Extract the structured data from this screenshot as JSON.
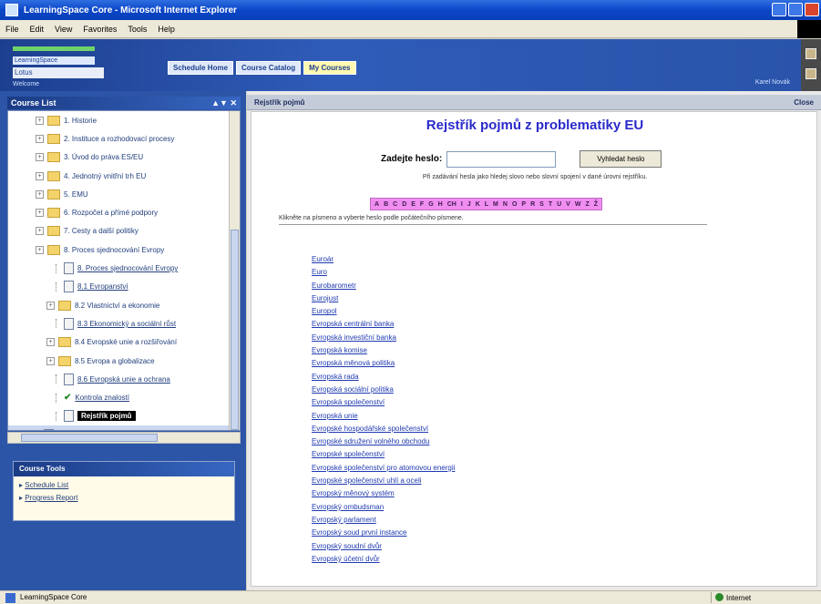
{
  "window": {
    "title": "LearningSpace Core - Microsoft Internet Explorer"
  },
  "menu": [
    "File",
    "Edit",
    "View",
    "Favorites",
    "Tools",
    "Help"
  ],
  "header": {
    "logo_lines": [
      "LearningSpace",
      "Lotus",
      "Welcome"
    ],
    "tabs": [
      "Schedule Home",
      "Course Catalog",
      "My Courses"
    ],
    "user": "Karel Novák"
  },
  "left": {
    "panel_title": "Course List",
    "panel_controls": "▲▼ ✕",
    "tree": [
      {
        "label": "1. Historie",
        "type": "folder",
        "expandable": true
      },
      {
        "label": "2. Instituce a rozhodovací procesy",
        "type": "folder",
        "expandable": true
      },
      {
        "label": "3. Úvod do práva ES/EU",
        "type": "folder",
        "expandable": true
      },
      {
        "label": "4. Jednotný vnitřní trh EU",
        "type": "folder",
        "expandable": true
      },
      {
        "label": "5. EMU",
        "type": "folder",
        "expandable": true
      },
      {
        "label": "6. Rozpočet a přímé podpory",
        "type": "folder",
        "expandable": true
      },
      {
        "label": "7. Cesty a další politiky",
        "type": "folder",
        "expandable": true
      },
      {
        "label": "8. Proces sjednocování Evropy",
        "type": "folder",
        "expandable": true
      },
      {
        "label": "8. Proces sjednocování Evropy",
        "type": "page",
        "link": true
      },
      {
        "label": "8.1 Evropanství",
        "type": "page",
        "link": true
      },
      {
        "label": "8.2 Vlastnictví a ekonomie",
        "type": "folder",
        "expandable": true
      },
      {
        "label": "8.3 Ekonomický a sociální růst",
        "type": "page",
        "link": true
      },
      {
        "label": "8.4 Evropské unie a rozšiřování",
        "type": "folder",
        "expandable": true
      },
      {
        "label": "8.5 Evropa a globalizace",
        "type": "folder",
        "expandable": true
      },
      {
        "label": "8.6 Evropská unie a ochrana",
        "type": "page",
        "link": true
      },
      {
        "label": "Kontrola znalostí",
        "type": "check",
        "link": true
      },
      {
        "label": "Rejstřík pojmů",
        "type": "page",
        "selected": true
      },
      {
        "label": "Rejstřík pojmů z problematiky EU",
        "type": "page",
        "footer": true
      }
    ],
    "tools": {
      "title": "Course Tools",
      "items": [
        "Schedule List",
        "Progress Report"
      ]
    }
  },
  "content": {
    "header": "Rejstřík pojmů",
    "close_label": "Close",
    "title": "Rejstřík pojmů z problematiky EU",
    "search_label": "Zadejte heslo:",
    "search_value": "",
    "search_button": "Vyhledat heslo",
    "hint": "Při zadávání hesla jako hledej slovo nebo slovní spojení v dané úrovni rejstříku.",
    "alphabet": [
      "A",
      "B",
      "C",
      "D",
      "E",
      "F",
      "G",
      "H",
      "CH",
      "I",
      "J",
      "K",
      "L",
      "M",
      "N",
      "O",
      "P",
      "R",
      "S",
      "T",
      "U",
      "V",
      "W",
      "Z",
      "Ž"
    ],
    "explain": "Klikněte na písmeno a vyberte heslo podle počátečního písmene.",
    "terms": [
      "Euroár",
      "Euro",
      "Eurobarometr",
      "Eurojust",
      "Europol",
      "Evropská centrální banka",
      "Evropská investiční banka",
      "Evropská komise",
      "Evropská měnová politika",
      "Evropská rada",
      "Evropská sociální politika",
      "Evropská společenství",
      "Evropská unie",
      "Evropské hospodářské společenství",
      "Evropské sdružení volného obchodu",
      "Evropské společenství",
      "Evropské společenství pro atomovou energii",
      "Evropské společenství uhlí a oceli",
      "Evropský měnový systém",
      "Evropský ombudsman",
      "Evropský parlament",
      "Evropský soud první instance",
      "Evropský soudní dvůr",
      "Evropský účetní dvůr"
    ]
  },
  "status": {
    "left": "LearningSpace Core",
    "zone": "Internet"
  }
}
